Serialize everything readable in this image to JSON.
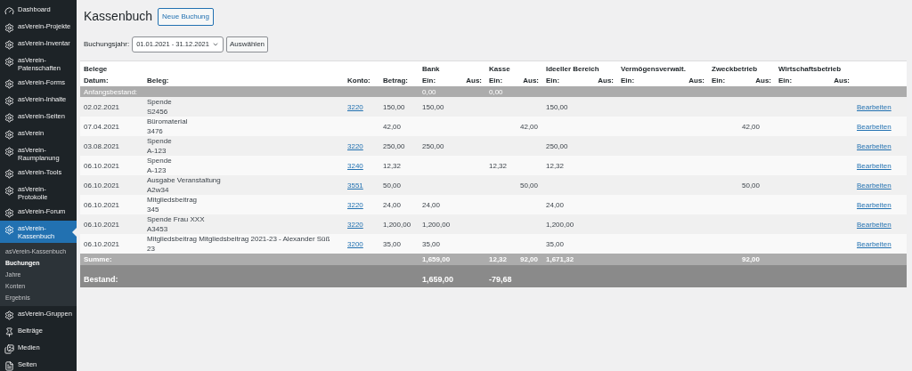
{
  "sidebar": {
    "items": [
      {
        "label": "Dashboard",
        "kind": "dashboard",
        "selected": false
      },
      {
        "label": "asVerein-Projekte",
        "kind": "gear",
        "selected": false
      },
      {
        "label": "asVerein-Inventar",
        "kind": "gear",
        "selected": false
      },
      {
        "label": "asVerein-Patenschaften",
        "kind": "gear",
        "selected": false
      },
      {
        "label": "asVerein-Forms",
        "kind": "gear",
        "selected": false
      },
      {
        "label": "asVerein-Inhalte",
        "kind": "gear",
        "selected": false
      },
      {
        "label": "asVerein-Seiten",
        "kind": "gear",
        "selected": false
      },
      {
        "label": "asVerein",
        "kind": "gear",
        "selected": false
      },
      {
        "label": "asVerein-Raumplanung",
        "kind": "gear",
        "selected": false
      },
      {
        "label": "asVerein-Tools",
        "kind": "gear",
        "selected": false
      },
      {
        "label": "asVerein-Protokolle",
        "kind": "gear",
        "selected": false
      },
      {
        "label": "asVerein-Forum",
        "kind": "gear",
        "selected": false
      },
      {
        "label": "asVerein-Kassenbuch",
        "kind": "gear",
        "selected": true,
        "children": [
          {
            "label": "asVerein-Kassenbuch",
            "selected": false
          },
          {
            "label": "Buchungen",
            "selected": true
          },
          {
            "label": "Jahre",
            "selected": false
          },
          {
            "label": "Konten",
            "selected": false
          },
          {
            "label": "Ergebnis",
            "selected": false
          }
        ]
      },
      {
        "label": "asVerein-Gruppen",
        "kind": "gear",
        "selected": false
      },
      {
        "label": "Beiträge",
        "kind": "pin",
        "selected": false
      },
      {
        "label": "Medien",
        "kind": "media",
        "selected": false
      },
      {
        "label": "Seiten",
        "kind": "pages",
        "selected": false
      }
    ]
  },
  "page": {
    "title": "Kassenbuch",
    "new_button": "Neue Buchung"
  },
  "filter": {
    "label": "Buchungsjahr:",
    "value": "01.01.2021 - 31.12.2021",
    "button": "Auswählen"
  },
  "table": {
    "group_headers": [
      "Belege",
      "Bank",
      "Kasse",
      "Ideeller Bereich",
      "Vermögensverwalt.",
      "Zweckbetrieb",
      "Wirtschaftsbetrieb"
    ],
    "columns": [
      "Datum:",
      "Beleg:",
      "Konto:",
      "Betrag:",
      "Ein:",
      "Aus:",
      "Ein:",
      "Aus:",
      "Ein:",
      "Aus:",
      "Ein:",
      "Aus:",
      "Ein:",
      "Aus:",
      "Ein:",
      "Aus:"
    ],
    "opening": {
      "label": "Anfangsbestand:",
      "amounts": {
        "bank_ein": "0,00",
        "kasse_ein": "0,00"
      }
    },
    "rows": [
      {
        "date": "02.02.2021",
        "beleg": [
          "Spende",
          "S2456"
        ],
        "konto": "3220",
        "betrag": "150,00",
        "amounts": {
          "bank_ein": "150,00",
          "ideell_ein": "150,00"
        },
        "action": "Bearbeiten"
      },
      {
        "date": "07.04.2021",
        "beleg": [
          "Büromaterial",
          "3476"
        ],
        "betrag": "42,00",
        "amounts": {
          "kasse_aus": "42,00",
          "zweck_aus": "42,00"
        },
        "action": "Bearbeiten"
      },
      {
        "date": "03.08.2021",
        "beleg": [
          "Spende",
          "A-123"
        ],
        "konto": "3220",
        "betrag": "250,00",
        "amounts": {
          "bank_ein": "250,00",
          "ideell_ein": "250,00"
        },
        "action": "Bearbeiten"
      },
      {
        "date": "06.10.2021",
        "beleg": [
          "Spende",
          "A-123"
        ],
        "konto": "3240",
        "betrag": "12,32",
        "amounts": {
          "kasse_ein": "12,32",
          "ideell_ein": "12,32"
        },
        "action": "Bearbeiten"
      },
      {
        "date": "06.10.2021",
        "beleg": [
          "Ausgabe Veranstaltung",
          "A2w34"
        ],
        "konto": "3551",
        "betrag": "50,00",
        "amounts": {
          "kasse_aus": "50,00",
          "zweck_aus": "50,00"
        },
        "action": "Bearbeiten"
      },
      {
        "date": "06.10.2021",
        "beleg": [
          "Mitgliedsbeitrag",
          "345"
        ],
        "konto": "3220",
        "betrag": "24,00",
        "amounts": {
          "bank_ein": "24,00",
          "ideell_ein": "24,00"
        },
        "action": "Bearbeiten"
      },
      {
        "date": "06.10.2021",
        "beleg": [
          "Spende Frau XXX",
          "A3453"
        ],
        "konto": "3220",
        "betrag": "1,200,00",
        "amounts": {
          "bank_ein": "1,200,00",
          "ideell_ein": "1,200,00"
        },
        "action": "Bearbeiten"
      },
      {
        "date": "06.10.2021",
        "beleg": [
          "Mitgliedsbeitrag Mitgliedsbeitrag 2021-23 - Alexander Süß",
          "23"
        ],
        "konto": "3200",
        "betrag": "35,00",
        "amounts": {
          "bank_ein": "35,00",
          "ideell_ein": "35,00"
        },
        "action": "Bearbeiten"
      }
    ],
    "sum": {
      "label": "Summe:",
      "amounts": {
        "bank_ein": "1,659,00",
        "kasse_ein": "12,32",
        "kasse_aus": "92,00",
        "ideell_ein": "1,671,32",
        "zweck_aus": "92,00"
      }
    },
    "balance": {
      "label": "Bestand:",
      "amounts": {
        "bank_ein": "1,659,00",
        "kasse_ein": "-79,68"
      }
    }
  }
}
